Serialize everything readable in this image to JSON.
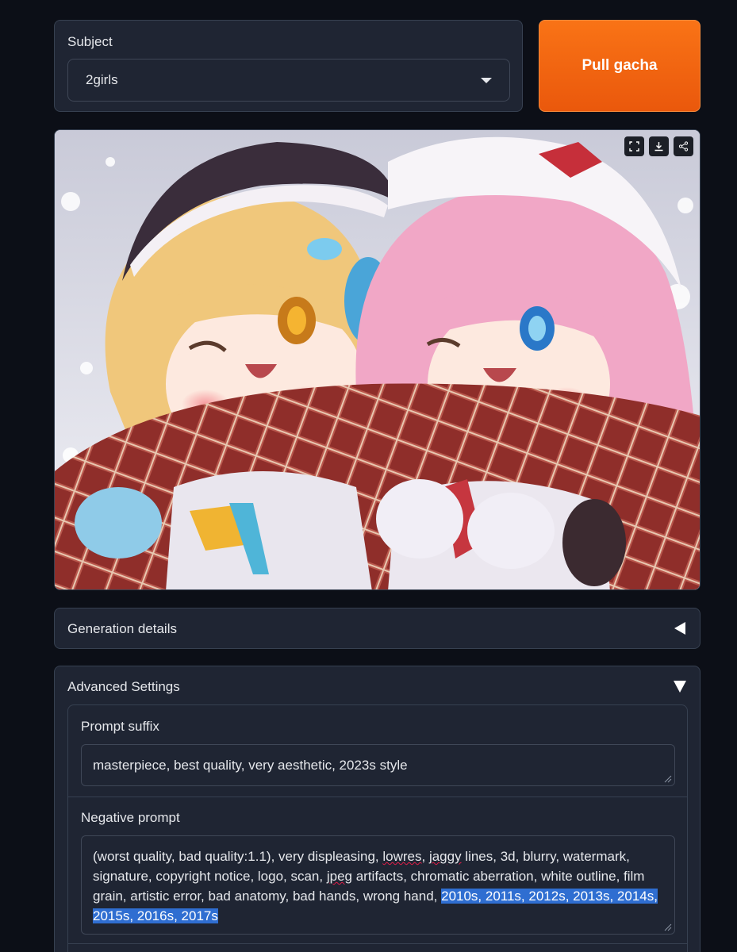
{
  "subject": {
    "label": "Subject",
    "selected": "2girls"
  },
  "pull_button": {
    "label": "Pull gacha"
  },
  "image_tools": [
    "fullscreen-icon",
    "download-icon",
    "share-icon"
  ],
  "generation_details": {
    "label": "Generation details"
  },
  "advanced_settings": {
    "label": "Advanced Settings",
    "prompt_suffix": {
      "label": "Prompt suffix",
      "value": "masterpiece, best quality, very aesthetic, 2023s style"
    },
    "negative_prompt": {
      "label": "Negative prompt",
      "parts": [
        "(worst quality, bad quality:1.1), very displeasing, ",
        "lowres",
        ", ",
        "jaggy",
        " lines, 3d, blurry, watermark, signature, copyright notice, logo, scan, ",
        "jpeg",
        " artifacts, chromatic aberration, white outline, film grain, artistic error, bad anatomy, bad hands, wrong hand, ",
        "2010s, 2011s, 2012s, 2013s, 2014s, 2015s, 2016s, 2017s"
      ]
    }
  },
  "colors": {
    "background": "#0c0f17",
    "panel": "#1f2533",
    "accent": "#f97316",
    "selection": "#2f6ed1"
  }
}
